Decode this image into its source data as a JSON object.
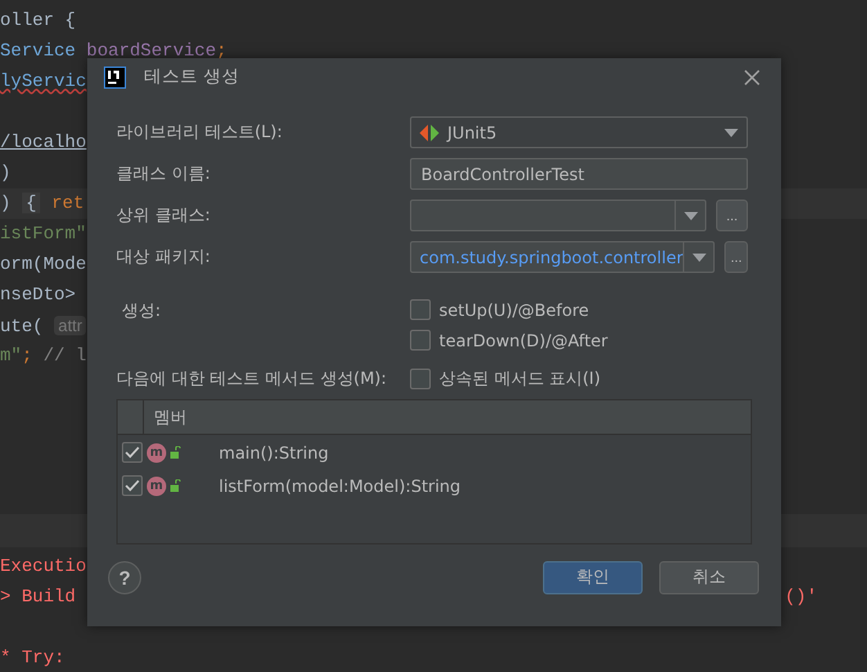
{
  "editor": {
    "lines": [
      {
        "segments": [
          {
            "kind": "plain",
            "text": "oller {"
          }
        ]
      },
      {
        "segments": [
          {
            "kind": "type",
            "text": "Service "
          },
          {
            "kind": "field",
            "text": "boardService"
          },
          {
            "kind": "keyword",
            "text": ";"
          }
        ]
      },
      {
        "segments": [
          {
            "kind": "error",
            "text": "lyServic"
          }
        ]
      },
      {
        "blank_before": true,
        "segments": [
          {
            "kind": "link",
            "text": "/localho"
          }
        ]
      },
      {
        "segments": [
          {
            "kind": "plain",
            "text": ")"
          }
        ]
      },
      {
        "current": true,
        "segments": [
          {
            "kind": "plain",
            "text": ") "
          },
          {
            "kind": "fold",
            "text": "{"
          },
          {
            "kind": "keyword",
            "text": " ret"
          }
        ]
      },
      {
        "segments": [
          {
            "kind": "string",
            "text": "istForm\""
          }
        ]
      },
      {
        "segments": [
          {
            "kind": "plain",
            "text": "orm(Mode"
          }
        ]
      },
      {
        "segments": [
          {
            "kind": "plain",
            "text": "nseDto> "
          }
        ]
      },
      {
        "segments": [
          {
            "kind": "plain",
            "text": "ute( "
          },
          {
            "kind": "hint",
            "text": "attr"
          }
        ]
      },
      {
        "segments": [
          {
            "kind": "string",
            "text": "m\""
          },
          {
            "kind": "keyword",
            "text": "; "
          },
          {
            "kind": "comment",
            "text": "// l"
          }
        ]
      }
    ]
  },
  "console": {
    "lines": [
      {
        "text": "Executio"
      },
      {
        "text": "> Build",
        "right": "()'"
      },
      {
        "text": "* Try:",
        "blank_before": true
      }
    ]
  },
  "dialog": {
    "title": "테스트 생성",
    "fields": [
      {
        "kind": "combo",
        "label": "라이브러리 테스트(L):",
        "value": "JUnit5"
      },
      {
        "kind": "text",
        "label": "클래스 이름:",
        "value": "BoardControllerTest"
      },
      {
        "kind": "combo-browse",
        "label": "상위 클래스:",
        "browse": "..."
      },
      {
        "kind": "combo-browse",
        "label": "대상 패키지:",
        "value": "com.study.springboot.controller",
        "browse": "..."
      }
    ],
    "generate": {
      "label": "생성:",
      "options": [
        {
          "label": "setUp(U)/@Before",
          "checked": false
        },
        {
          "label": "tearDown(D)/@After",
          "checked": false
        }
      ]
    },
    "methods": {
      "label": "다음에 대한 테스트 메서드 생성(M):",
      "inherited": {
        "label": "상속된 메서드 표시(I)",
        "checked": false
      },
      "column": "멤버",
      "rows": [
        {
          "badge": "m",
          "signature": "main():String",
          "checked": true
        },
        {
          "badge": "m",
          "signature": "listForm(model:Model):String",
          "checked": true
        }
      ]
    },
    "help": "?",
    "buttons": [
      {
        "label": "확인",
        "default": true
      },
      {
        "label": "취소",
        "default": false
      }
    ]
  }
}
